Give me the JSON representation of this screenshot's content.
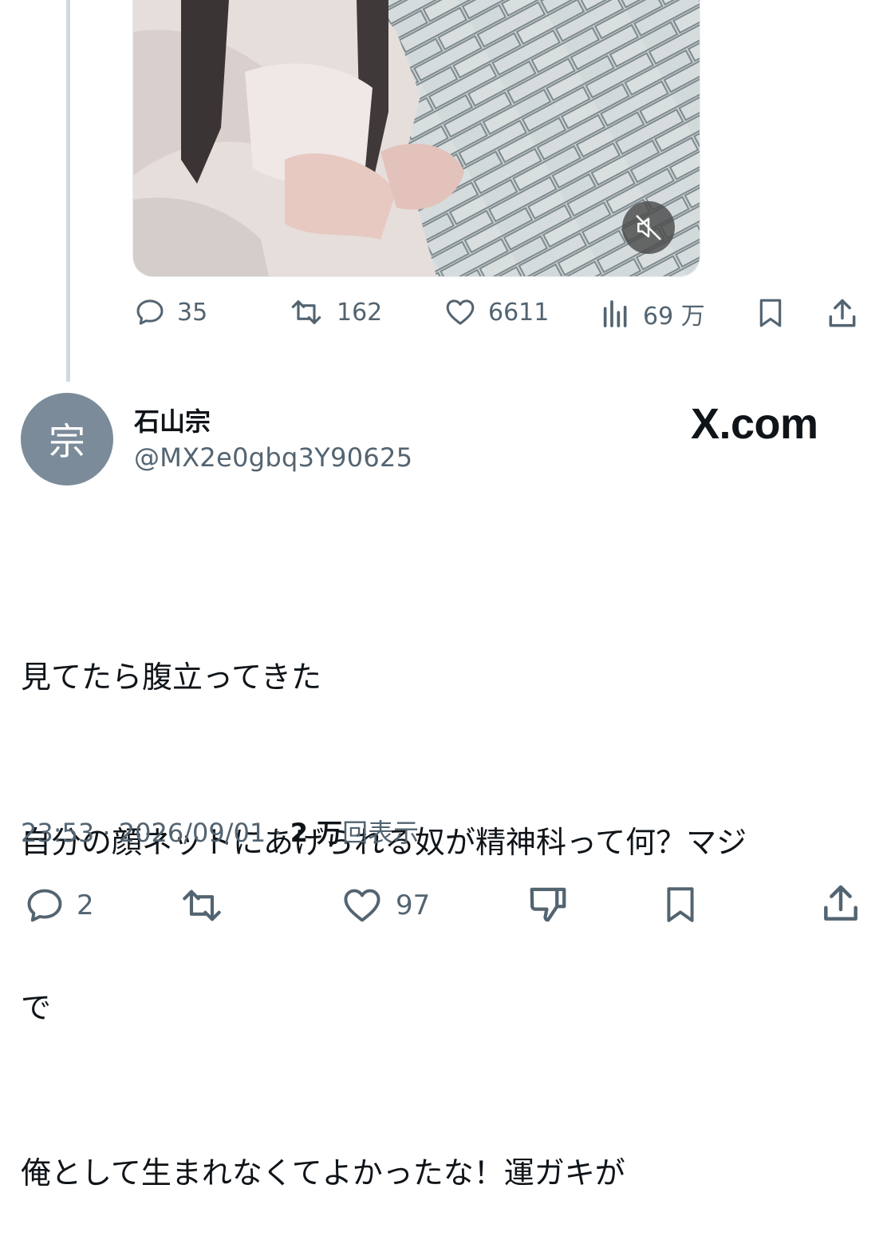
{
  "embedded_tweet": {
    "media": {
      "type": "video",
      "muted": true,
      "mute_icon": "speaker-mute-icon"
    },
    "actions": {
      "reply_count": "35",
      "repost_count": "162",
      "like_count": "6611",
      "views_count": "69 万"
    }
  },
  "reply_tweet": {
    "avatar_char": "宗",
    "display_name": "石山宗",
    "handle": "@MX2e0gbq3Y90625",
    "watermark": "X.com",
    "text_lines": [
      "見てたら腹立ってきた",
      "自分の顔ネットにあげられる奴が精神科って何？マジ",
      "で",
      "俺として生まれなくてよかったな！運ガキが"
    ],
    "time": "23:53",
    "date": "2026/09/01",
    "views_bold": "2 万",
    "views_label": "回表示",
    "actions": {
      "reply_count": "2",
      "like_count": "97"
    }
  },
  "colors": {
    "text": "#0f1419",
    "muted": "#536471",
    "line": "#cfd9de",
    "avatar": "#7b8b99"
  }
}
